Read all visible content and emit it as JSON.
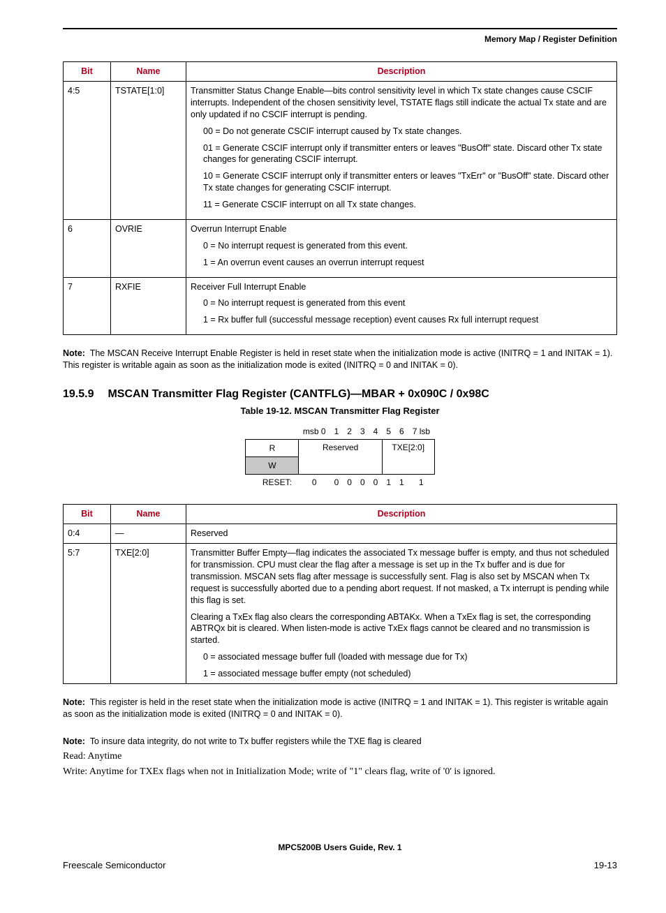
{
  "running_head": "Memory Map / Register Definition",
  "table1": {
    "headers": {
      "bit": "Bit",
      "name": "Name",
      "desc": "Description"
    },
    "rows": [
      {
        "bit": "4:5",
        "name": "TSTATE[1:0]",
        "p1": "Transmitter Status Change Enable—bits control sensitivity level in which Tx state changes cause CSCIF interrupts. Independent of the chosen sensitivity level, TSTATE flags still indicate the actual Tx state and are only updated if no CSCIF interrupt is pending.",
        "i1": "00 = Do not generate CSCIF interrupt caused by Tx state changes.",
        "i2": "01 = Generate CSCIF interrupt only if transmitter enters or leaves \"BusOff\" state. Discard other Tx state changes for generating CSCIF interrupt.",
        "i3": "10 = Generate CSCIF interrupt only if transmitter enters or leaves \"TxErr\" or \"BusOff\" state. Discard other Tx state changes for generating CSCIF interrupt.",
        "i4": "11 = Generate CSCIF interrupt on all Tx state changes."
      },
      {
        "bit": "6",
        "name": "OVRIE",
        "p1": "Overrun Interrupt Enable",
        "i1": "0 = No interrupt request is generated from this event.",
        "i2": "1 = An overrun event causes an overrun interrupt request"
      },
      {
        "bit": "7",
        "name": "RXFIE",
        "p1": "Receiver Full Interrupt Enable",
        "i1": "0 = No interrupt request is generated from this event",
        "i2": "1 = Rx buffer full (successful message reception) event causes Rx full interrupt request"
      }
    ]
  },
  "note1": {
    "label": "Note:",
    "text": "The MSCAN Receive Interrupt Enable Register is held in reset state when the initialization mode is active (INITRQ = 1 and INITAK = 1). This register is writable again as soon as the initialization mode is exited (INITRQ = 0 and INITAK = 0)."
  },
  "section": {
    "num": "19.5.9",
    "title": "MSCAN Transmitter Flag Register (CANTFLG)—MBAR + 0x090C / 0x98C"
  },
  "bitfield_caption": "Table 19-12. MSCAN Transmitter Flag Register",
  "bitfield": {
    "header": [
      "msb 0",
      "1",
      "2",
      "3",
      "4",
      "5",
      "6",
      "7 lsb"
    ],
    "row_r": "R",
    "row_w": "W",
    "reserved_label": "Reserved",
    "txe_label": "TXE[2:0]",
    "reset_label": "RESET:",
    "reset": [
      "0",
      "0",
      "0",
      "0",
      "0",
      "1",
      "1",
      "1"
    ]
  },
  "table2": {
    "headers": {
      "bit": "Bit",
      "name": "Name",
      "desc": "Description"
    },
    "rows": [
      {
        "bit": "0:4",
        "name": "—",
        "p1": "Reserved"
      },
      {
        "bit": "5:7",
        "name": "TXE[2:0]",
        "p1": "Transmitter Buffer Empty—flag indicates the associated Tx message buffer is empty, and thus not scheduled for transmission. CPU must clear the flag after a message is set up in the Tx buffer and is due for transmission. MSCAN sets flag after message is successfully sent. Flag is also set by MSCAN when Tx request is successfully aborted due to a pending abort request. If not masked, a Tx interrupt is pending while this flag is set.",
        "p2": "Clearing a TxEx flag also clears the corresponding ABTAKx. When a TxEx flag is set, the corresponding ABTRQx bit is cleared. When listen-mode is active TxEx flags cannot be cleared and no transmission is started.",
        "i1": "0 = associated message buffer full (loaded with message due for Tx)",
        "i2": "1 = associated message buffer empty (not scheduled)"
      }
    ]
  },
  "note2": {
    "label": "Note:",
    "text": "This register is held in the reset state when the initialization mode is active (INITRQ = 1 and INITAK = 1). This register is writable again as soon as the initialization mode is exited (INITRQ = 0 and INITAK = 0)."
  },
  "note3": {
    "label": "Note:",
    "text": "To insure data integrity, do not write to Tx buffer registers while the TXE flag is cleared"
  },
  "body_read": "Read: Anytime",
  "body_write": "Write: Anytime for TXEx flags when not in Initialization Mode; write of \"1\" clears flag, write of '0' is ignored.",
  "footer": {
    "title": "MPC5200B Users Guide, Rev. 1",
    "left": "Freescale Semiconductor",
    "right": "19-13"
  }
}
